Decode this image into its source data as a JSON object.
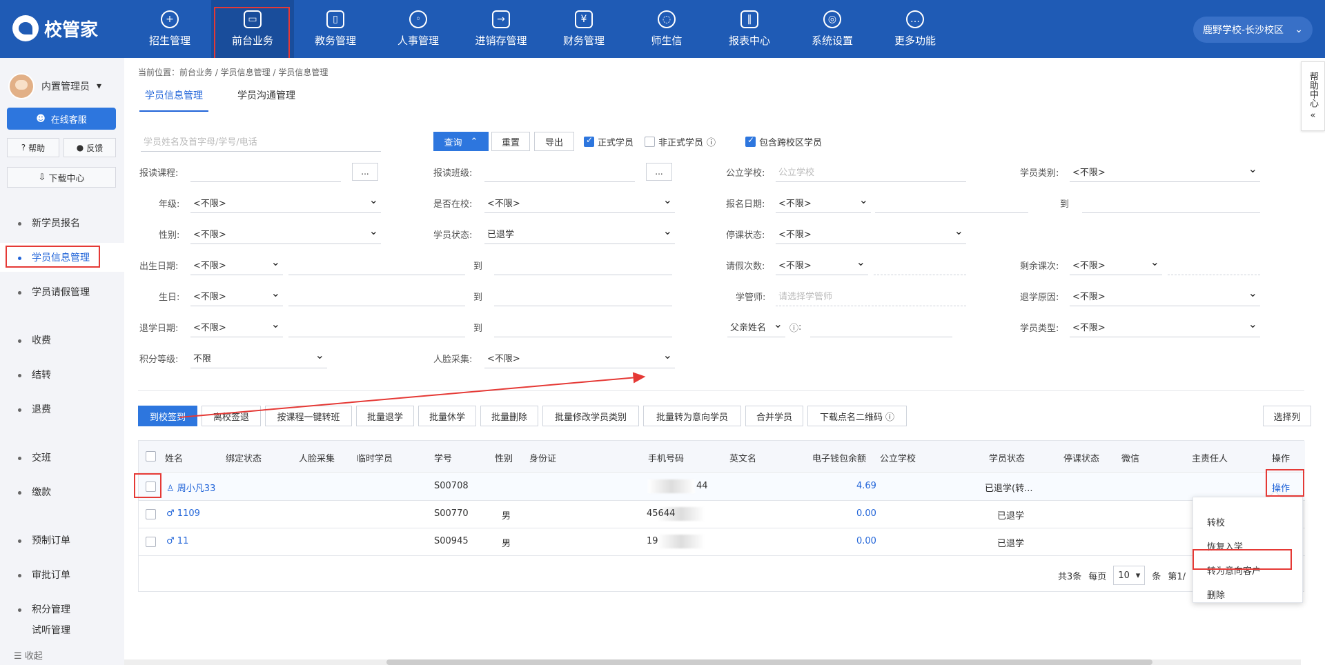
{
  "app": {
    "brand": "校管家",
    "campus": "鹿野学校-长沙校区",
    "help_center": "帮助中心"
  },
  "nav": [
    "招生管理",
    "前台业务",
    "教务管理",
    "人事管理",
    "进销存管理",
    "财务管理",
    "师生信",
    "报表中心",
    "系统设置",
    "更多功能"
  ],
  "sidebar": {
    "user": "内置管理员",
    "online_service": "在线客服",
    "help": "帮助",
    "feedback": "反馈",
    "download_center": "下载中心",
    "items": [
      "新学员报名",
      "学员信息管理",
      "学员请假管理",
      "收费",
      "结转",
      "退费",
      "交班",
      "缴款",
      "预制订单",
      "审批订单",
      "积分管理",
      "试听管理"
    ],
    "collapse": "收起"
  },
  "breadcrumb": "当前位置：前台业务 / 学员信息管理 / 学员信息管理",
  "tabs": [
    "学员信息管理",
    "学员沟通管理"
  ],
  "search": {
    "placeholder": "学员姓名及首字母/学号/电话",
    "query": "查询",
    "reset": "重置",
    "export": "导出",
    "formal": "正式学员",
    "informal": "非正式学员",
    "cross_campus": "包含跨校区学员"
  },
  "filters": {
    "course": "报读课程:",
    "class": "报读班级:",
    "public_school": "公立学校:",
    "public_school_placeholder": "公立学校",
    "student_type": "学员类别:",
    "grade": "年级:",
    "at_school": "是否在校:",
    "signup_date": "报名日期:",
    "to": "到",
    "gender": "性别:",
    "status": "学员状态:",
    "stop_status": "停课状态:",
    "birth_date": "出生日期:",
    "leave_times": "请假次数:",
    "remaining_lessons": "剩余课次:",
    "birthday": "生日:",
    "manager": "学管师:",
    "manager_placeholder": "请选择学管师",
    "leave_reason": "退学原因:",
    "leave_date": "退学日期:",
    "father_name": "父亲姓名",
    "student_kind": "学员类型:",
    "points_level": "积分等级:",
    "face": "人脸采集:",
    "unlimited": "<不限>",
    "unlimited_points": "不限",
    "status_value": "已退学",
    "dots": "...",
    "colon": ":"
  },
  "actions": [
    "到校签到",
    "离校签退",
    "按课程一键转班",
    "批量退学",
    "批量休学",
    "批量删除",
    "批量修改学员类别",
    "批量转为意向学员",
    "合并学员",
    "下载点名二维码",
    "选择列"
  ],
  "table": {
    "headers": [
      "姓名",
      "绑定状态",
      "人脸采集",
      "临时学员",
      "学号",
      "性别",
      "身份证",
      "手机号码",
      "英文名",
      "电子钱包余额",
      "公立学校",
      "学员状态",
      "停课状态",
      "微信",
      "主责任人",
      "操作"
    ],
    "rows": [
      {
        "name": "周小凡33",
        "id": "S00708",
        "gender": "",
        "phone": "44",
        "wallet": "4.69",
        "status": "已退学(转...",
        "op": "操作"
      },
      {
        "name": "1109",
        "id": "S00770",
        "gender": "男",
        "phone": "45644",
        "wallet": "0.00",
        "status": "已退学",
        "op": ""
      },
      {
        "name": "11",
        "id": "S00945",
        "gender": "男",
        "phone": "19",
        "wallet": "0.00",
        "status": "已退学",
        "op": ""
      }
    ]
  },
  "pager": {
    "total": "共3条",
    "per_page": "每页",
    "page_size": "10",
    "unit": "条",
    "page": "第1/"
  },
  "dropdown": [
    "转校",
    "恢复入学",
    "转为意向客户",
    "删除"
  ],
  "colors": {
    "blue": "#1f5bb5",
    "accent": "#2d76de",
    "red": "#e53935"
  }
}
